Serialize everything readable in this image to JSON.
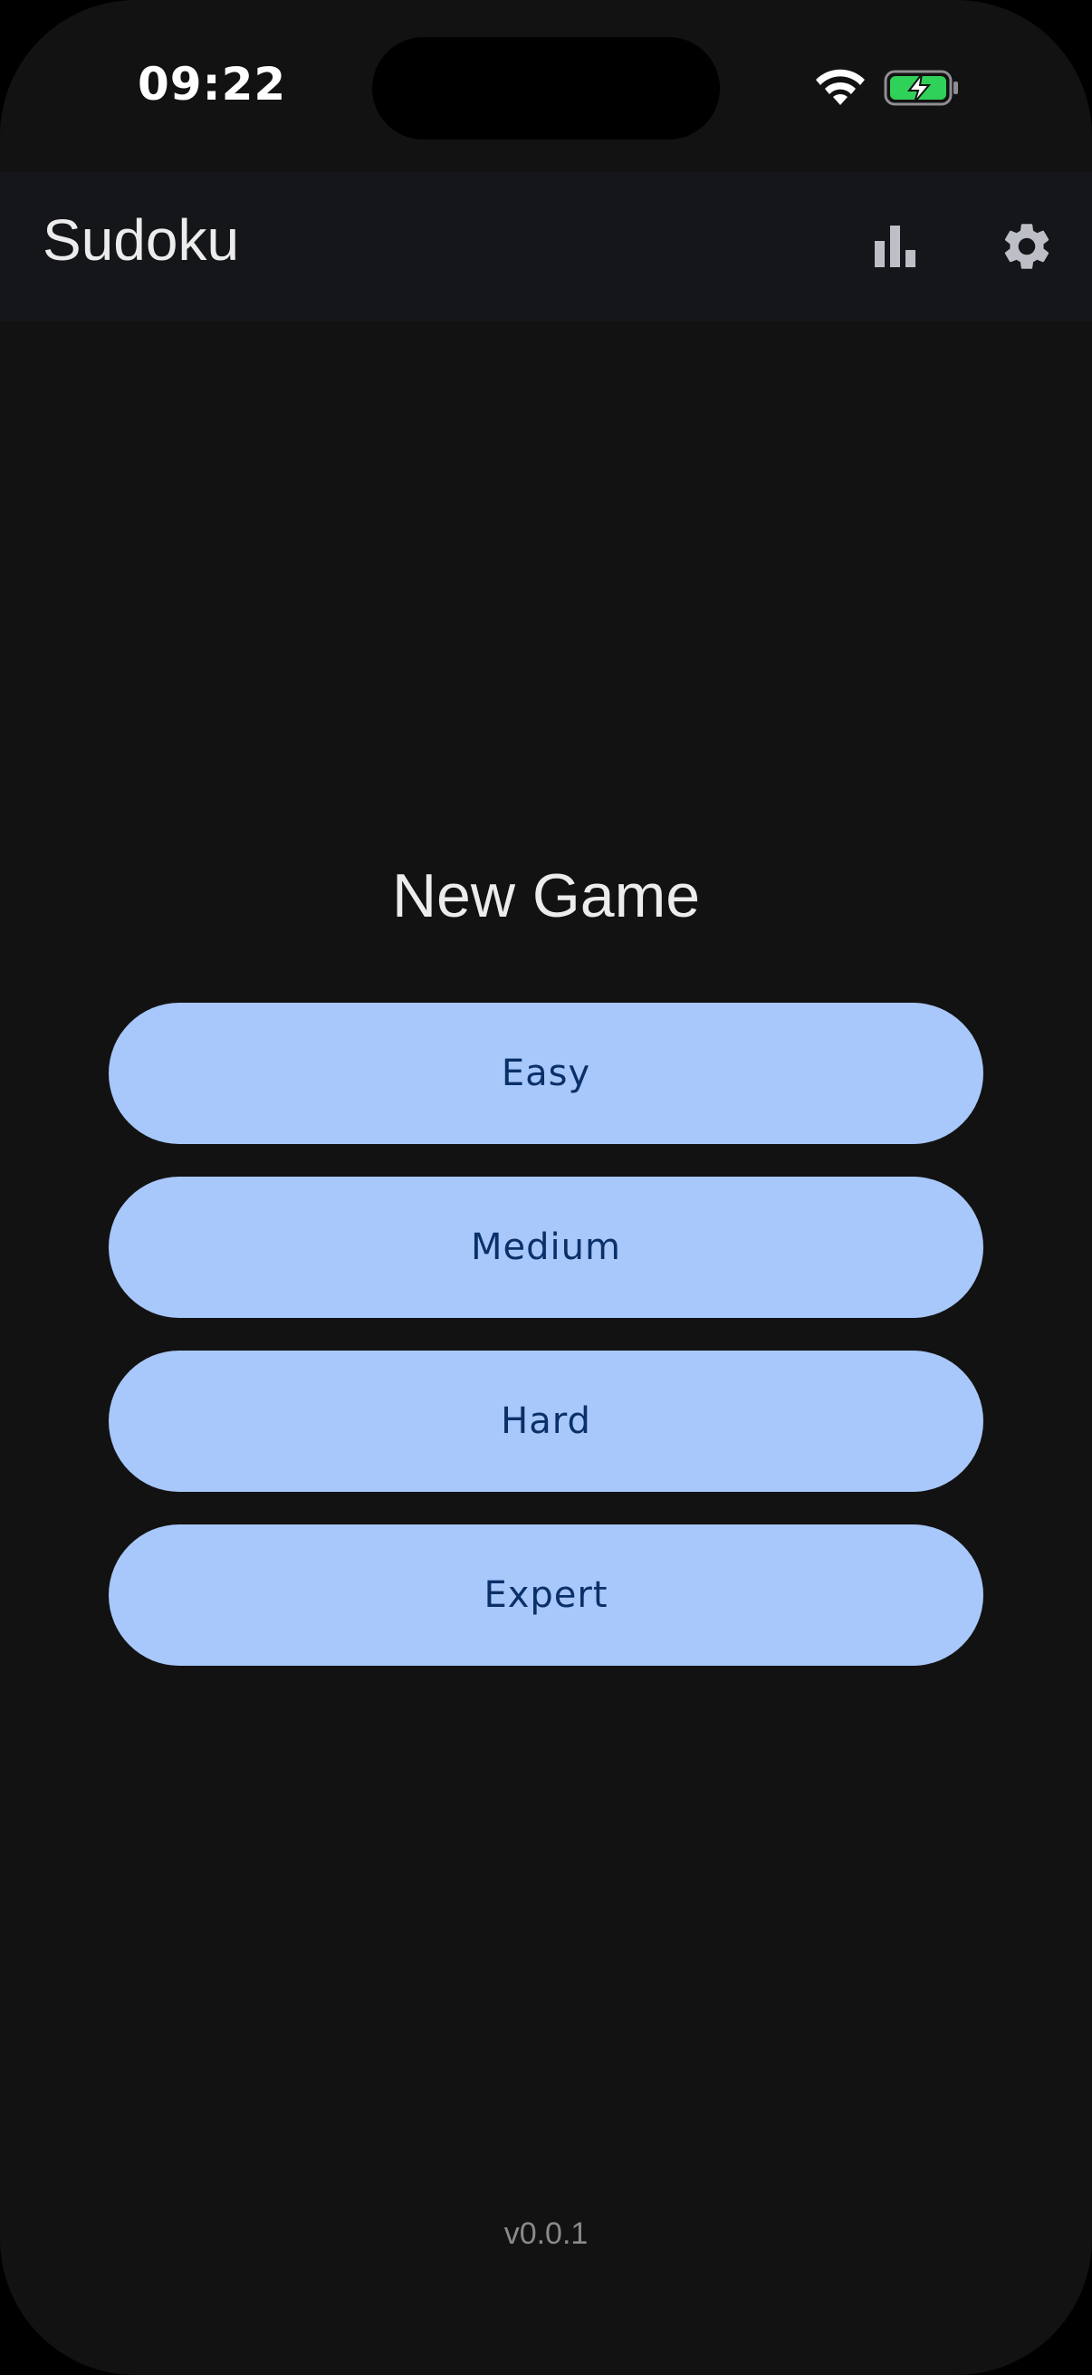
{
  "status_bar": {
    "time": "09:22",
    "wifi_icon": "wifi-icon",
    "battery_icon": "battery-charging-icon",
    "battery_color": "#30d158"
  },
  "app_bar": {
    "title": "Sudoku",
    "stats_icon": "bar-chart-icon",
    "settings_icon": "gear-icon"
  },
  "main": {
    "heading": "New Game",
    "difficulties": [
      {
        "label": "Easy"
      },
      {
        "label": "Medium"
      },
      {
        "label": "Hard"
      },
      {
        "label": "Expert"
      }
    ],
    "version": "v0.0.1"
  },
  "colors": {
    "background": "#121212",
    "app_bar_background": "#15161a",
    "button_background": "#a8c7fa",
    "button_text": "#0a3069",
    "icon_color": "#bcbfc6"
  }
}
